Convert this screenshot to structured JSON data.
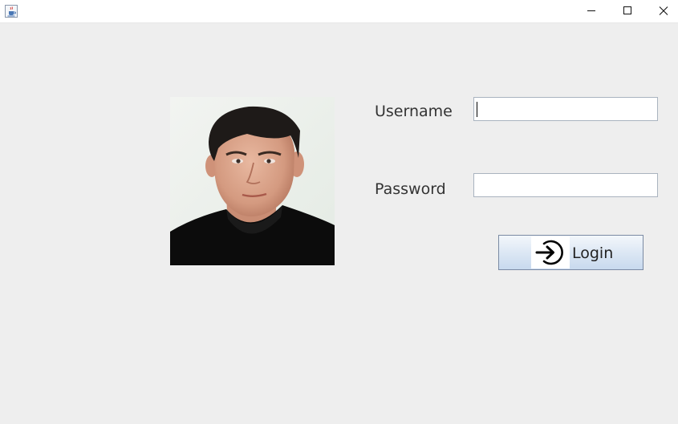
{
  "window": {
    "app_icon": "java-cup-icon",
    "controls": [
      "minimize-icon",
      "maximize-icon",
      "close-icon"
    ]
  },
  "profile_photo": {
    "icon": "user-portrait-photo"
  },
  "form": {
    "username_label": "Username",
    "username_value": "",
    "password_label": "Password",
    "password_value": ""
  },
  "login_button": {
    "label": "Login",
    "icon": "login-arrow-icon"
  }
}
